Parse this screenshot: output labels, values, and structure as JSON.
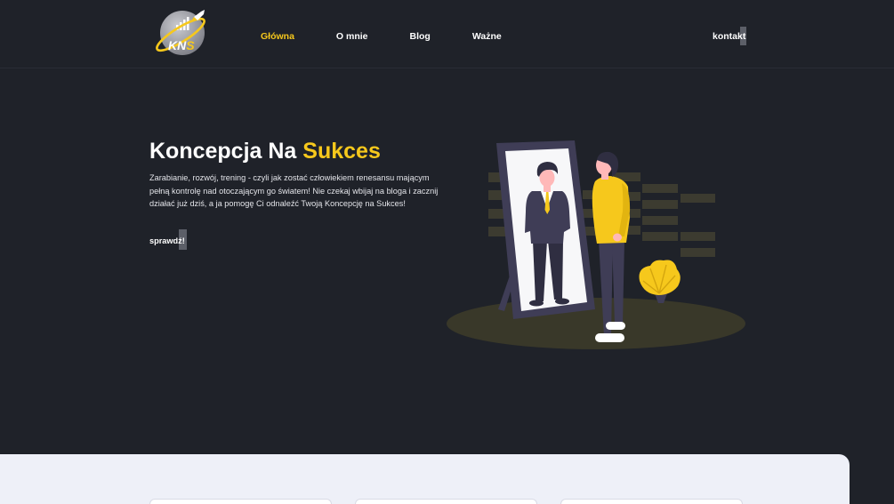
{
  "colors": {
    "background": "#1f2229",
    "accent": "#f6c81c",
    "text": "#ffffff",
    "section": "#eef0f8"
  },
  "logo": {
    "text": "KNS",
    "icon": "rocket-icon"
  },
  "nav": {
    "items": [
      {
        "label": "Główna",
        "active": true
      },
      {
        "label": "O mnie",
        "active": false
      },
      {
        "label": "Blog",
        "active": false
      },
      {
        "label": "Ważne",
        "active": false
      }
    ],
    "contact_label": "kontakt"
  },
  "hero": {
    "title": "Koncepcja Na",
    "title_highlight": "Sukces",
    "description": "Zarabianie, rozwój, trening - czyli jak zostać człowiekiem renesansu mającym pełną kontrolę nad otoczającym go światem! Nie czekaj wbijaj na bloga i zacznij działać już dziś, a ja pomogę Ci odnaleźć Twoją Koncepcję na Sukces!",
    "cta_label": "sprawdź!"
  }
}
